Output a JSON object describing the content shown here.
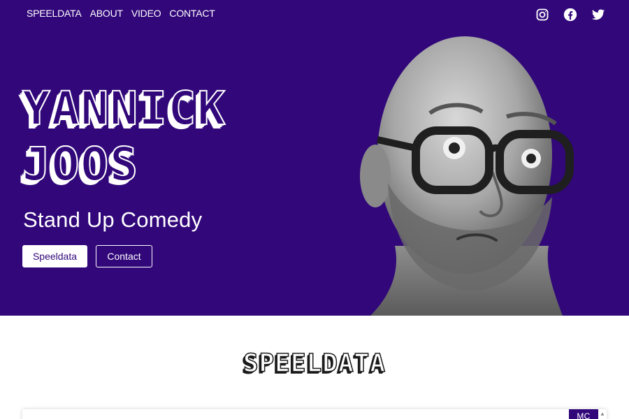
{
  "nav": {
    "items": [
      "SPEELDATA",
      "ABOUT",
      "VIDEO",
      "CONTACT"
    ]
  },
  "social": {
    "icons": [
      "instagram-icon",
      "facebook-icon",
      "twitter-icon"
    ]
  },
  "hero": {
    "title_line1": "YANNICK",
    "title_line2": "JOOS",
    "subtitle": "Stand Up Comedy",
    "primary_button": "Speeldata",
    "secondary_button": "Contact",
    "background_color": "#31077a"
  },
  "section": {
    "title": "SPEELDATA",
    "tag": "MC"
  },
  "colors": {
    "accent": "#31077a",
    "text_light": "#ffffff",
    "text_dark": "#1b1b1b"
  }
}
